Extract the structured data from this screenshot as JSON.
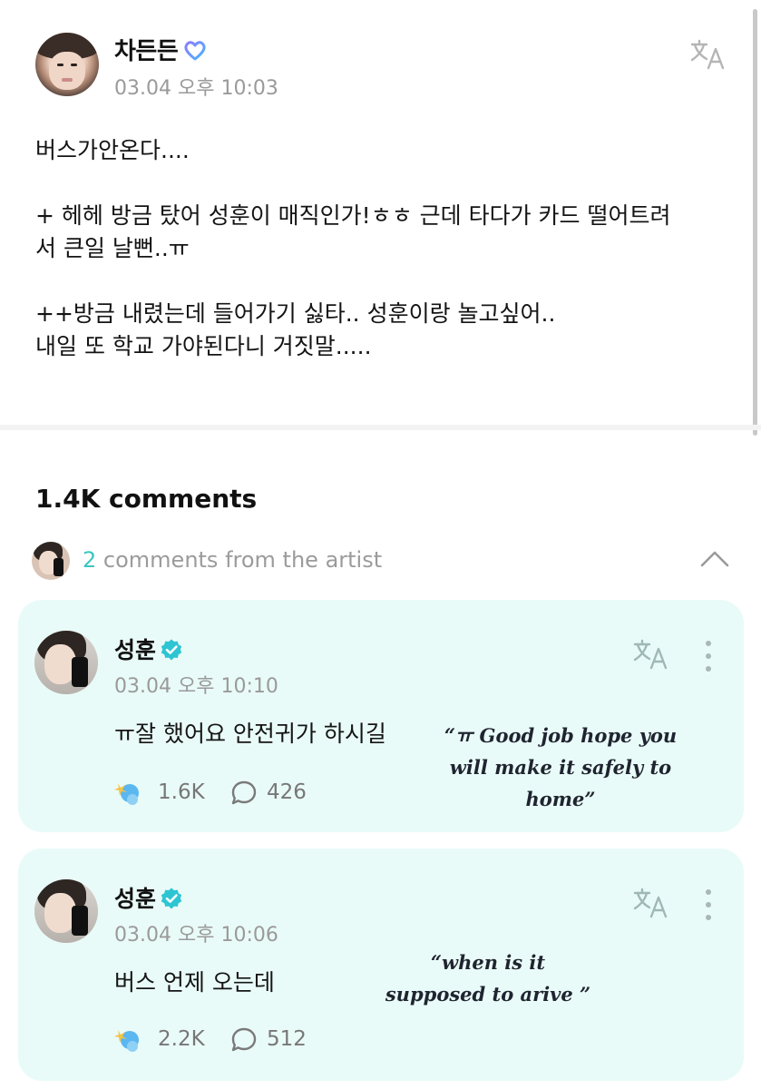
{
  "post": {
    "author": "차든든",
    "time": "03.04 오후 10:03",
    "body": "버스가안온다....\n\n+ 헤헤 방금 탔어 성훈이 매직인가!ㅎㅎ 근데 타다가 카드 떨어트려\n서 큰일 날뻔..ㅠ\n\n++방금 내렸는데 들어가기 싫타.. 성훈이랑 놀고싶어..\n내일 또 학교 가야된다니 거짓말....."
  },
  "comments_header": {
    "count_label": "1.4K comments",
    "artist_count": "2",
    "artist_label": " comments from the artist"
  },
  "comments": [
    {
      "author": "성훈",
      "time": "03.04 오후 10:10",
      "text": "ㅠ잘 했어요 안전귀가 하시길",
      "annotation": "“ㅠ Good job hope you will make it safely to home”",
      "likes": "1.6K",
      "replies": "426"
    },
    {
      "author": "성훈",
      "time": "03.04 오후 10:06",
      "text": "버스 언제 오는데",
      "annotation": "“when is it supposed to arive ”",
      "likes": "2.2K",
      "replies": "512"
    }
  ],
  "colors": {
    "accent": "#3cc6c1",
    "card_bg": "#e9fbf8",
    "verified": "#2ec5d3",
    "heart_gradient": [
      "#8a7dff",
      "#4ab4ff"
    ]
  },
  "icons": {
    "translate": "translate-icon",
    "more": "more-vertical-icon",
    "comment": "comment-bubble-icon",
    "reaction": "reaction-emoji-icon",
    "chevron": "chevron-up-icon",
    "verified": "verified-badge-icon",
    "heart": "heart-badge-icon"
  }
}
